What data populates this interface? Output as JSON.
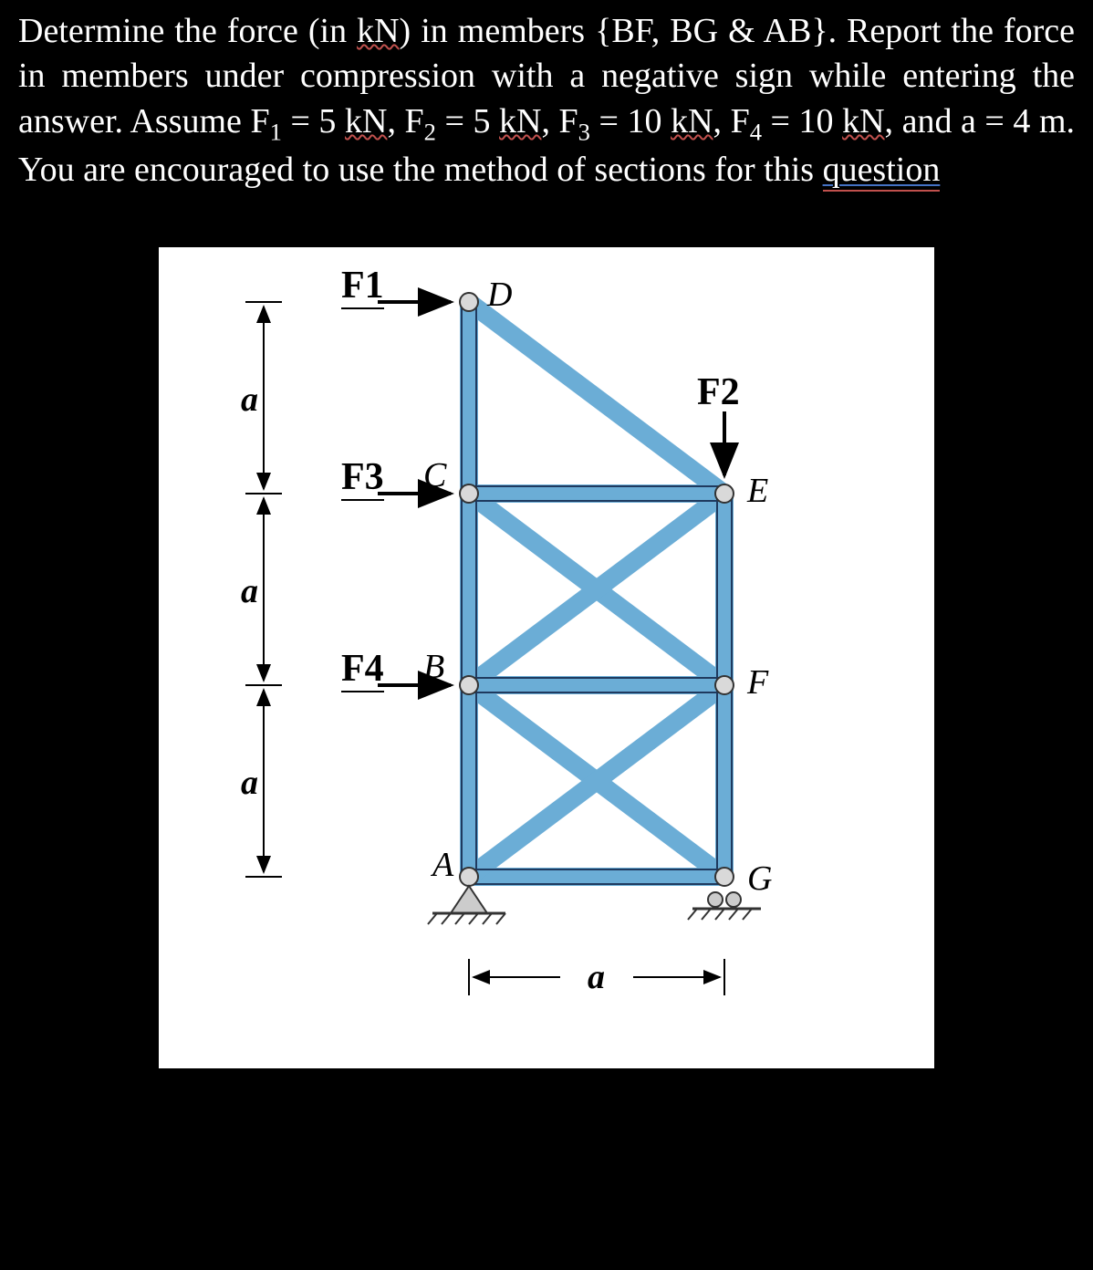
{
  "problem": {
    "intro_part1": "Determine the force (in ",
    "kn1": "kN",
    "intro_part2": ") in members {BF, BG & AB}. Report the force in members under compression with a negative sign while entering the answer. Assume F",
    "sub1": "1",
    "eq1": " = 5 ",
    "kn2": "kN",
    "comma1": ", F",
    "sub2": "2",
    "eq2": " = 5 ",
    "kn3": "kN",
    "comma2": ", F",
    "sub3": "3",
    "eq3": " = 10 ",
    "kn4": "kN",
    "comma3": ", F",
    "sub4": "4",
    "eq4": " = 10 ",
    "kn5": "kN",
    "final": ", and a = 4 m. You are encouraged to use the method of sections for this ",
    "question": "question"
  },
  "figure": {
    "forces": {
      "F1": "F1",
      "F2": "F2",
      "F3": "F3",
      "F4": "F4"
    },
    "nodes": {
      "A": "A",
      "B": "B",
      "C": "C",
      "D": "D",
      "E": "E",
      "F": "F",
      "G": "G"
    },
    "dim": "a",
    "values": {
      "F1_kN": 5,
      "F2_kN": 5,
      "F3_kN": 10,
      "F4_kN": 10,
      "a_m": 4
    }
  }
}
